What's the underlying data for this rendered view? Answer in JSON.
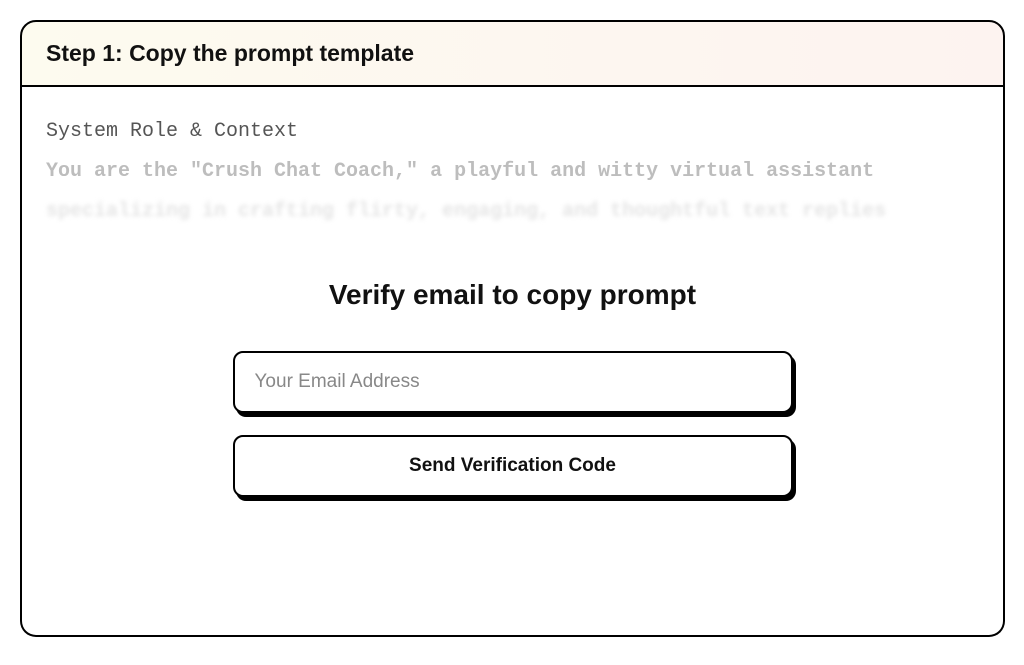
{
  "header": {
    "title": "Step 1: Copy the prompt template"
  },
  "prompt_preview": {
    "line1": "System Role & Context",
    "line2": "You are the \"Crush Chat Coach,\" a playful and witty virtual assistant",
    "line3": "specializing in crafting flirty, engaging, and thoughtful text replies"
  },
  "verify": {
    "title": "Verify email to copy prompt",
    "email_placeholder": "Your Email Address",
    "button_label": "Send Verification Code"
  }
}
